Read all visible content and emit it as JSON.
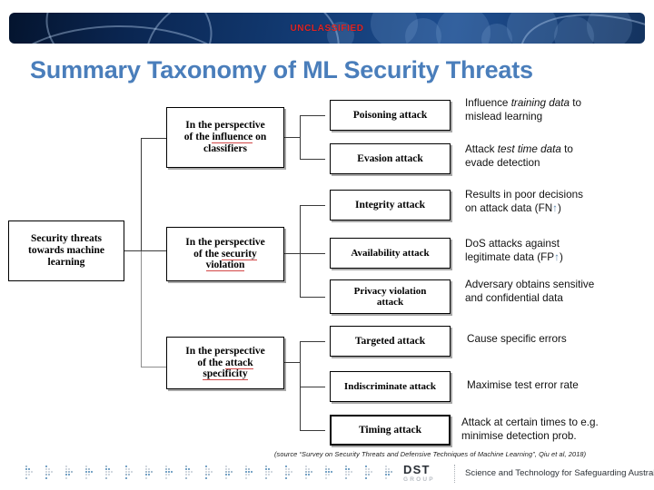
{
  "header": {
    "classification": "UNCLASSIFIED"
  },
  "slide": {
    "title": "Summary Taxonomy of ML Security Threats"
  },
  "diagram": {
    "root": {
      "label_line1": "Security threats",
      "label_line2": "towards machine",
      "label_line3": "learning"
    },
    "perspectives": [
      {
        "pre": "In the perspective",
        "mid_a": "of the ",
        "highlight": "influence",
        "mid_b": " on",
        "post": "classifiers"
      },
      {
        "pre": "In the perspective",
        "mid_a": "of the ",
        "highlight": "security",
        "mid_b": "",
        "post": "violation"
      },
      {
        "pre": "In the perspective",
        "mid_a": "of the ",
        "highlight": "attack",
        "mid_b": "",
        "post": "specificity"
      }
    ],
    "attacks": [
      {
        "label": "Poisoning attack"
      },
      {
        "label": "Evasion attack"
      },
      {
        "label": "Integrity attack"
      },
      {
        "label": "Availability attack"
      },
      {
        "label_line1": "Privacy violation",
        "label_line2": "attack"
      },
      {
        "label": "Targeted attack"
      },
      {
        "label": "Indiscriminate attack"
      },
      {
        "label": "Timing attack"
      }
    ],
    "descriptions": [
      {
        "p1": "Influence ",
        "em": "training data",
        "p2": " to",
        "l2": "mislead learning"
      },
      {
        "p1": "Attack ",
        "em": "test time data",
        "p2": " to",
        "l2": "evade detection"
      },
      {
        "p1": "Results in poor decisions",
        "em": "",
        "p2": "",
        "l2": "on attack data  (FN",
        "arrow": "↑",
        "l3": ")"
      },
      {
        "p1": "DoS attacks against",
        "em": "",
        "p2": "",
        "l2": "legitimate data (FP",
        "arrow": "↑",
        "l3": ")"
      },
      {
        "p1": "Adversary obtains sensitive",
        "em": "",
        "p2": "",
        "l2": "and confidential data"
      },
      {
        "p1": "Cause specific errors",
        "em": "",
        "p2": "",
        "l2": ""
      },
      {
        "p1": "Maximise test error rate",
        "em": "",
        "p2": "",
        "l2": ""
      },
      {
        "p1": "Attack at certain times to e.g.",
        "em": "",
        "p2": "",
        "l2": "minimise detection prob."
      }
    ]
  },
  "source": {
    "caption": "(source “Survey on Security Threats and Defensive Techniques of Machine Learning”, Qiu et al, 2018)"
  },
  "footer": {
    "logo_main": "DST",
    "logo_sub": "GROUP",
    "tagline": "Science and Technology for Safeguarding Australia"
  },
  "colors": {
    "title": "#4a7ebb",
    "classification": "#e02424",
    "banner_dark": "#04142e",
    "banner_light": "#1d4d8f",
    "underline": "#d24747",
    "arrow": "#5d87ab"
  }
}
